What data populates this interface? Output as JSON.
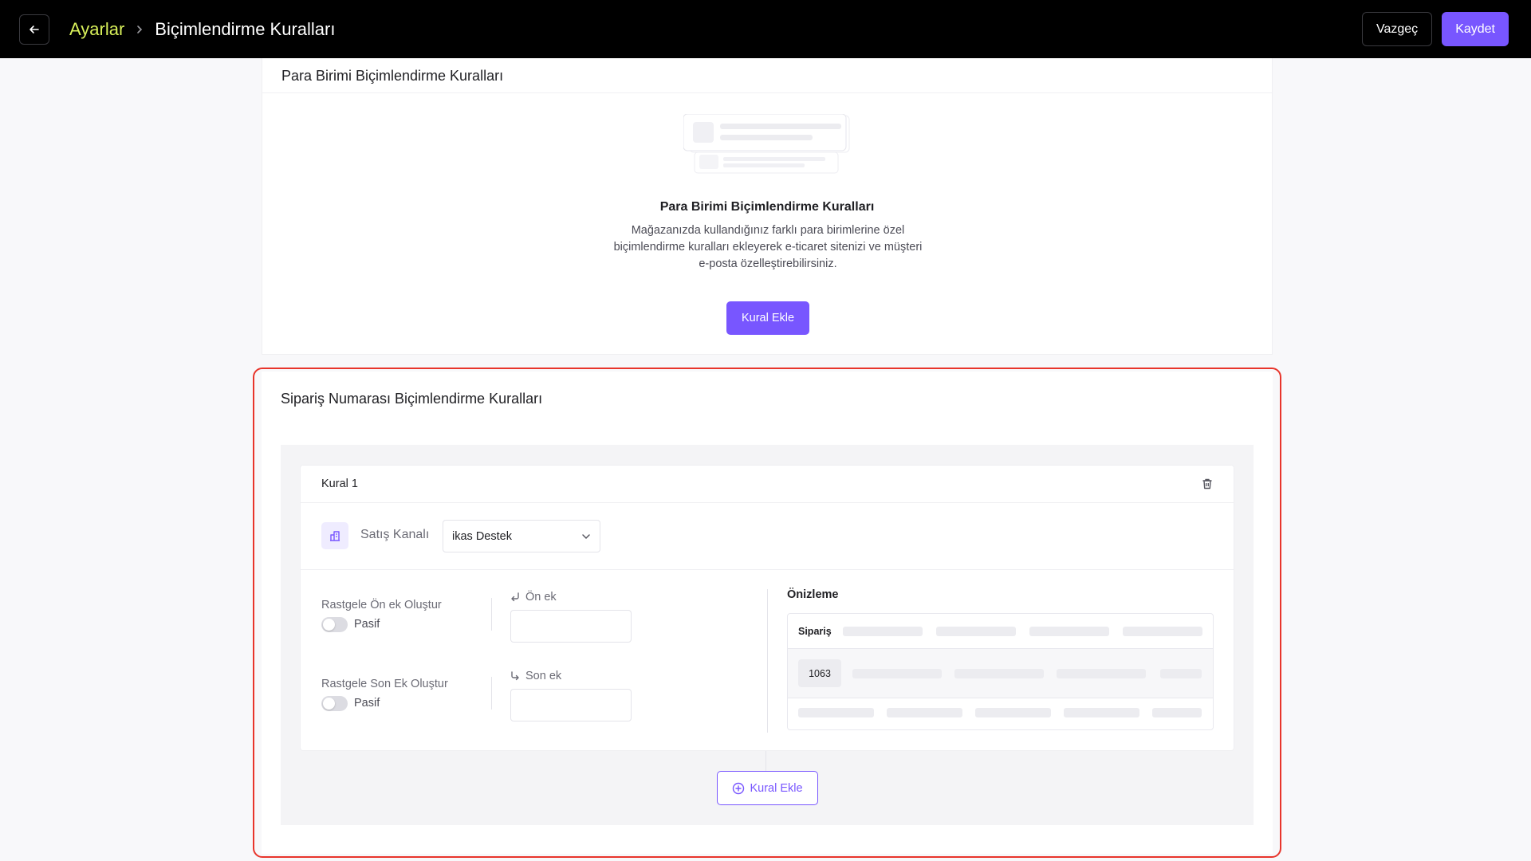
{
  "header": {
    "breadcrumb_root": "Ayarlar",
    "breadcrumb_current": "Biçimlendirme Kuralları",
    "cancel_label": "Vazgeç",
    "save_label": "Kaydet"
  },
  "currency_section": {
    "title": "Para Birimi Biçimlendirme Kuralları",
    "empty_title": "Para Birimi Biçimlendirme Kuralları",
    "empty_description": "Mağazanızda kullandığınız farklı para birimlerine özel biçimlendirme kuralları ekleyerek e-ticaret sitenizi ve müşteri e-posta özelleştirebilirsiniz.",
    "add_rule_label": "Kural Ekle"
  },
  "order_section": {
    "title": "Sipariş Numarası Biçimlendirme Kuralları",
    "rule": {
      "name": "Kural 1",
      "channel_label": "Satış Kanalı",
      "channel_value": "ikas Destek",
      "random_prefix_label": "Rastgele Ön ek Oluştur",
      "random_prefix_status": "Pasif",
      "random_suffix_label": "Rastgele Son Ek Oluştur",
      "random_suffix_status": "Pasif",
      "prefix_label": "Ön ek",
      "prefix_value": "",
      "suffix_label": "Son ek",
      "suffix_value": "",
      "preview_title": "Önizleme",
      "preview_header": "Sipariş",
      "preview_order_number": "1063"
    },
    "add_rule_label": "Kural Ekle"
  },
  "colors": {
    "accent": "#7856ff",
    "topbar": "#000000",
    "breadcrumb_root": "#d8f05a",
    "highlight": "#e8352b"
  }
}
